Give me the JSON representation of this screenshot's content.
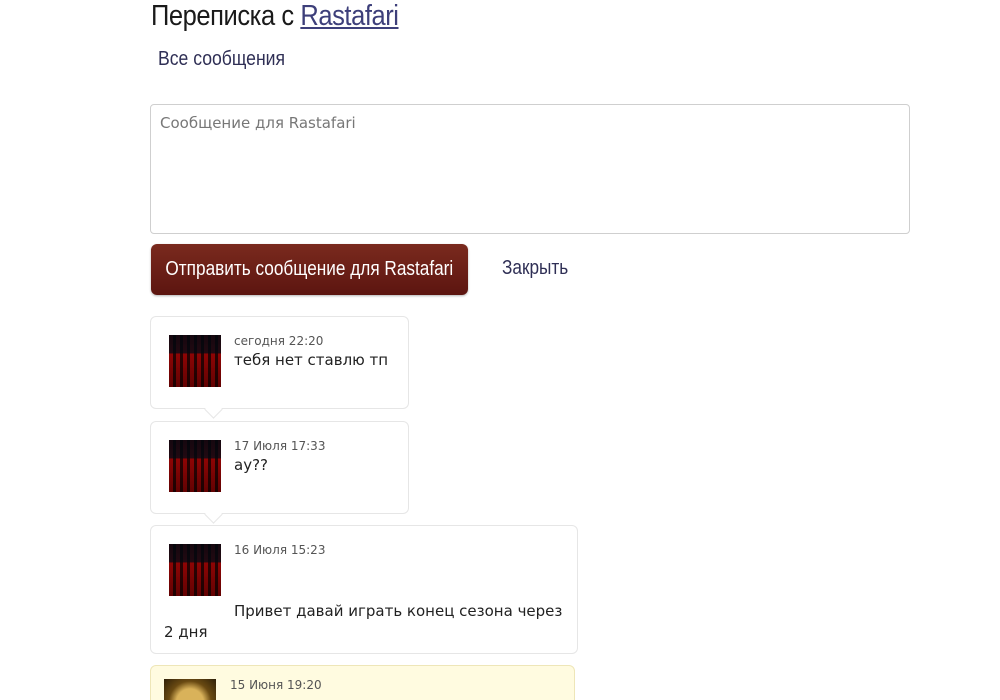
{
  "header": {
    "title_prefix": "Переписка с",
    "title_user": "Rastafari",
    "all_messages_link": "Все сообщения"
  },
  "composer": {
    "placeholder": "Сообщение для Rastafari",
    "send_label": "Отправить сообщение для Rastafari",
    "close_label": "Закрыть"
  },
  "messages": [
    {
      "date": "сегодня 22:20",
      "text": "тебя нет ставлю тп"
    },
    {
      "date": "17 Июля 17:33",
      "text": "ау??"
    },
    {
      "date": "16 Июля 15:23",
      "text": "Привет давай играть конец сезона через 2 дня"
    },
    {
      "date": "15 Июня 19:20",
      "text": ""
    }
  ],
  "colors": {
    "send_button": "#6b1f16",
    "link": "#3d3f7a",
    "unread_background": "#fffbe0"
  }
}
